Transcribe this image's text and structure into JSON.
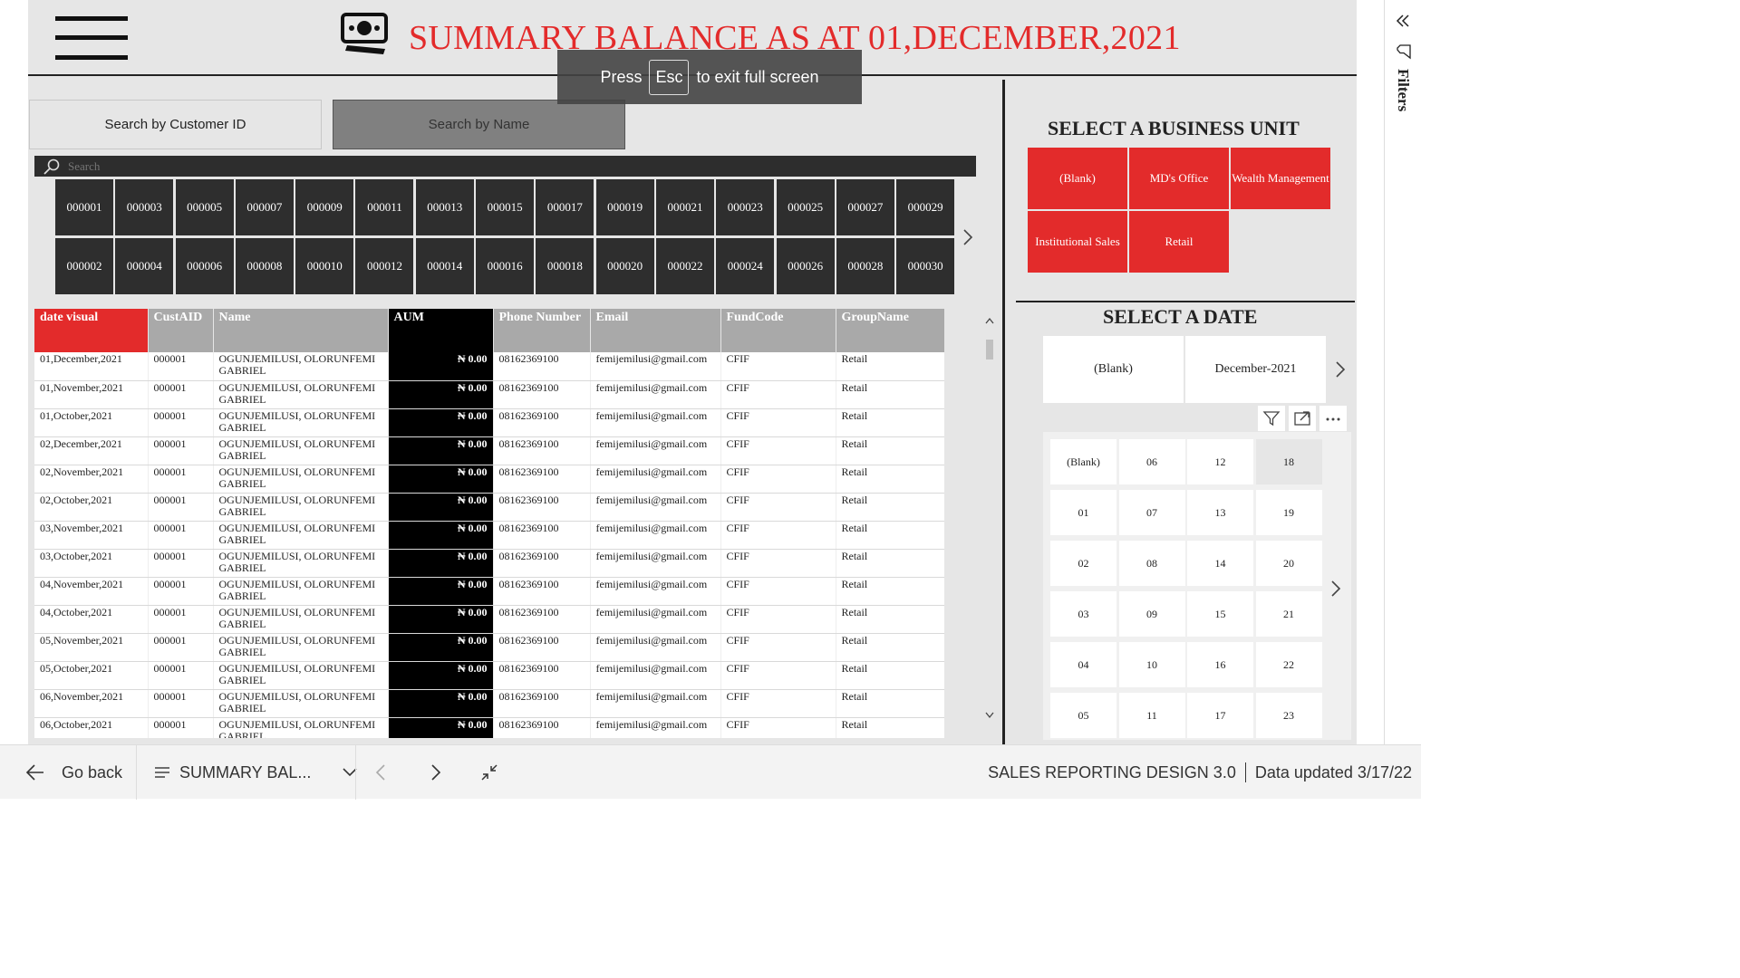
{
  "header": {
    "title": "SUMMARY BALANCE AS AT 01,DECEMBER,2021"
  },
  "fullscreen_toast": {
    "prefix": "Press",
    "key": "Esc",
    "suffix": "to exit full screen"
  },
  "search_tabs": {
    "by_id": "Search by Customer ID",
    "by_name": "Search by Name"
  },
  "search": {
    "placeholder": "Search"
  },
  "customer_tiles": {
    "row1": [
      "000001",
      "000003",
      "000005",
      "000007",
      "000009",
      "000011",
      "000013",
      "000015",
      "000017",
      "000019",
      "000021",
      "000023",
      "000025",
      "000027",
      "000029"
    ],
    "row2": [
      "000002",
      "000004",
      "000006",
      "000008",
      "000010",
      "000012",
      "000014",
      "000016",
      "000018",
      "000020",
      "000022",
      "000024",
      "000026",
      "000028",
      "000030"
    ]
  },
  "table": {
    "columns": [
      "date visual",
      "CustAID",
      "Name",
      "AUM",
      "Phone Number",
      "Email",
      "FundCode",
      "GroupName"
    ],
    "rows": [
      [
        "01,December,2021",
        "000001",
        "OGUNJEMILUSI, OLORUNFEMI GABRIEL",
        "₦ 0.00",
        "08162369100",
        "femijemilusi@gmail.com",
        "CFIF",
        "Retail"
      ],
      [
        "01,November,2021",
        "000001",
        "OGUNJEMILUSI, OLORUNFEMI GABRIEL",
        "₦ 0.00",
        "08162369100",
        "femijemilusi@gmail.com",
        "CFIF",
        "Retail"
      ],
      [
        "01,October,2021",
        "000001",
        "OGUNJEMILUSI, OLORUNFEMI GABRIEL",
        "₦ 0.00",
        "08162369100",
        "femijemilusi@gmail.com",
        "CFIF",
        "Retail"
      ],
      [
        "02,December,2021",
        "000001",
        "OGUNJEMILUSI, OLORUNFEMI GABRIEL",
        "₦ 0.00",
        "08162369100",
        "femijemilusi@gmail.com",
        "CFIF",
        "Retail"
      ],
      [
        "02,November,2021",
        "000001",
        "OGUNJEMILUSI, OLORUNFEMI GABRIEL",
        "₦ 0.00",
        "08162369100",
        "femijemilusi@gmail.com",
        "CFIF",
        "Retail"
      ],
      [
        "02,October,2021",
        "000001",
        "OGUNJEMILUSI, OLORUNFEMI GABRIEL",
        "₦ 0.00",
        "08162369100",
        "femijemilusi@gmail.com",
        "CFIF",
        "Retail"
      ],
      [
        "03,November,2021",
        "000001",
        "OGUNJEMILUSI, OLORUNFEMI GABRIEL",
        "₦ 0.00",
        "08162369100",
        "femijemilusi@gmail.com",
        "CFIF",
        "Retail"
      ],
      [
        "03,October,2021",
        "000001",
        "OGUNJEMILUSI, OLORUNFEMI GABRIEL",
        "₦ 0.00",
        "08162369100",
        "femijemilusi@gmail.com",
        "CFIF",
        "Retail"
      ],
      [
        "04,November,2021",
        "000001",
        "OGUNJEMILUSI, OLORUNFEMI GABRIEL",
        "₦ 0.00",
        "08162369100",
        "femijemilusi@gmail.com",
        "CFIF",
        "Retail"
      ],
      [
        "04,October,2021",
        "000001",
        "OGUNJEMILUSI, OLORUNFEMI GABRIEL",
        "₦ 0.00",
        "08162369100",
        "femijemilusi@gmail.com",
        "CFIF",
        "Retail"
      ],
      [
        "05,November,2021",
        "000001",
        "OGUNJEMILUSI, OLORUNFEMI GABRIEL",
        "₦ 0.00",
        "08162369100",
        "femijemilusi@gmail.com",
        "CFIF",
        "Retail"
      ],
      [
        "05,October,2021",
        "000001",
        "OGUNJEMILUSI, OLORUNFEMI GABRIEL",
        "₦ 0.00",
        "08162369100",
        "femijemilusi@gmail.com",
        "CFIF",
        "Retail"
      ],
      [
        "06,November,2021",
        "000001",
        "OGUNJEMILUSI, OLORUNFEMI GABRIEL",
        "₦ 0.00",
        "08162369100",
        "femijemilusi@gmail.com",
        "CFIF",
        "Retail"
      ],
      [
        "06,October,2021",
        "000001",
        "OGUNJEMILUSI, OLORUNFEMI GABRIEL",
        "₦ 0.00",
        "08162369100",
        "femijemilusi@gmail.com",
        "CFIF",
        "Retail"
      ]
    ]
  },
  "business_unit": {
    "title": "SELECT A BUSINESS UNIT",
    "options": [
      "(Blank)",
      "MD's Office",
      "Wealth Management",
      "Institutional Sales",
      "Retail"
    ]
  },
  "date_select": {
    "title": "SELECT A DATE",
    "months": [
      "(Blank)",
      "December-2021"
    ],
    "days": [
      "(Blank)",
      "06",
      "12",
      "18",
      "01",
      "07",
      "13",
      "19",
      "02",
      "08",
      "14",
      "20",
      "03",
      "09",
      "15",
      "21",
      "04",
      "10",
      "16",
      "22",
      "05",
      "11",
      "17",
      "23"
    ],
    "selected_day": "18"
  },
  "filters_pane": {
    "label": "Filters"
  },
  "bottom_bar": {
    "go_back": "Go back",
    "page_name": "SUMMARY BAL...",
    "report_name": "SALES REPORTING DESIGN 3.0",
    "data_updated": "Data updated 3/17/22"
  },
  "colors": {
    "accent_red": "#e32b2b",
    "tile_dark": "#2e2e2e",
    "aum_black": "#000000",
    "canvas_grey": "#e6e6e6"
  },
  "icons": [
    "hamburger-menu-icon",
    "money-icon",
    "search-icon",
    "chevron-right-icon",
    "filter-icon",
    "focus-mode-icon",
    "more-options-icon",
    "collapse-pane-icon",
    "filter-funnel-icon",
    "back-arrow-icon",
    "page-list-icon",
    "chevron-down-icon",
    "chevron-left-icon",
    "exit-fullscreen-icon"
  ]
}
